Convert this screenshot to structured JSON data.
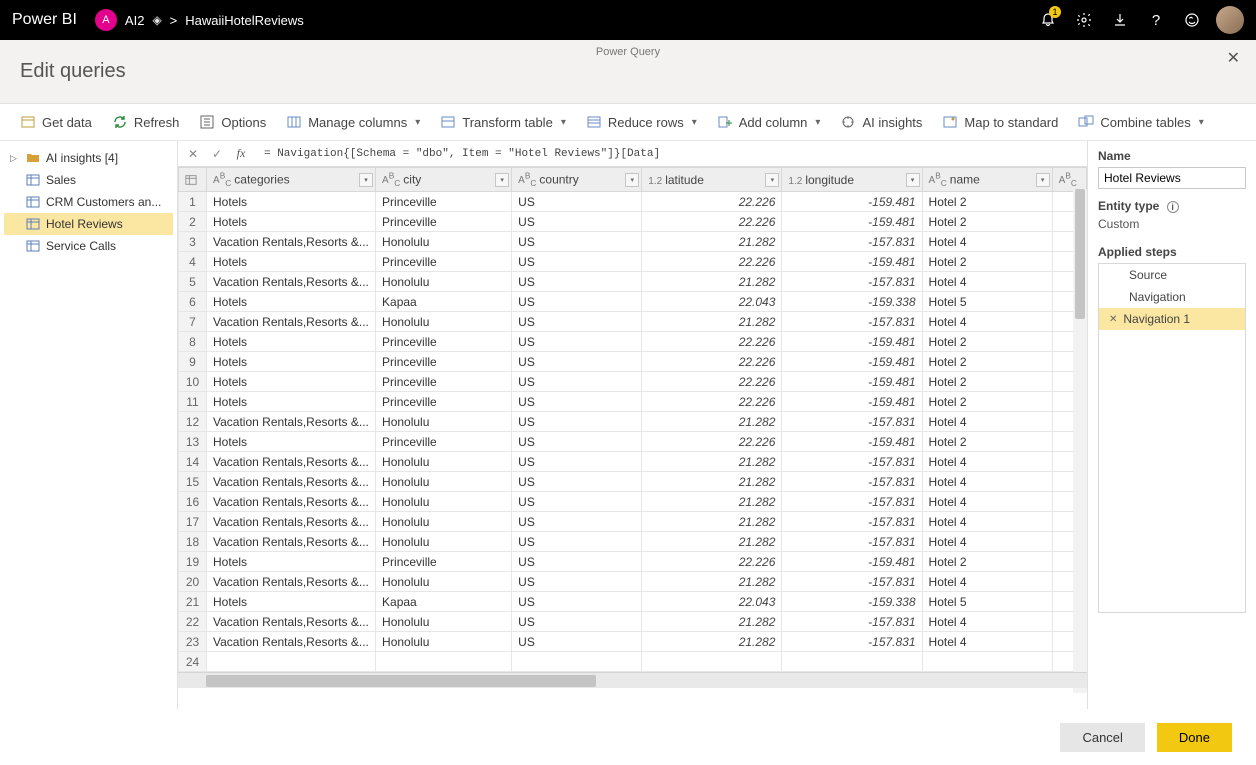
{
  "titlebar": {
    "app_name": "Power BI",
    "workspace_initial": "A",
    "workspace_name": "AI2",
    "breadcrumb_sep": ">",
    "file_name": "HawaiiHotelReviews",
    "notif_count": "1"
  },
  "dialog": {
    "subtitle": "Power Query",
    "title": "Edit queries"
  },
  "ribbon": {
    "get_data": "Get data",
    "refresh": "Refresh",
    "options": "Options",
    "manage_columns": "Manage columns",
    "transform_table": "Transform table",
    "reduce_rows": "Reduce rows",
    "add_column": "Add column",
    "ai_insights": "AI insights",
    "map_standard": "Map to standard",
    "combine_tables": "Combine tables"
  },
  "queries": {
    "folder": "AI insights [4]",
    "items": [
      "Sales",
      "CRM Customers an...",
      "Hotel Reviews",
      "Service Calls"
    ],
    "selected_index": 2
  },
  "formula": "=   Navigation{[Schema = \"dbo\", Item = \"Hotel Reviews\"]}[Data]",
  "columns": [
    {
      "name": "categories",
      "type": "text"
    },
    {
      "name": "city",
      "type": "text"
    },
    {
      "name": "country",
      "type": "text"
    },
    {
      "name": "latitude",
      "type": "number"
    },
    {
      "name": "longitude",
      "type": "number"
    },
    {
      "name": "name",
      "type": "text"
    }
  ],
  "rows": [
    {
      "n": 1,
      "categories": "Hotels",
      "city": "Princeville",
      "country": "US",
      "latitude": "22.226",
      "longitude": "-159.481",
      "name": "Hotel 2"
    },
    {
      "n": 2,
      "categories": "Hotels",
      "city": "Princeville",
      "country": "US",
      "latitude": "22.226",
      "longitude": "-159.481",
      "name": "Hotel 2"
    },
    {
      "n": 3,
      "categories": "Vacation Rentals,Resorts &...",
      "city": "Honolulu",
      "country": "US",
      "latitude": "21.282",
      "longitude": "-157.831",
      "name": "Hotel 4"
    },
    {
      "n": 4,
      "categories": "Hotels",
      "city": "Princeville",
      "country": "US",
      "latitude": "22.226",
      "longitude": "-159.481",
      "name": "Hotel 2"
    },
    {
      "n": 5,
      "categories": "Vacation Rentals,Resorts &...",
      "city": "Honolulu",
      "country": "US",
      "latitude": "21.282",
      "longitude": "-157.831",
      "name": "Hotel 4"
    },
    {
      "n": 6,
      "categories": "Hotels",
      "city": "Kapaa",
      "country": "US",
      "latitude": "22.043",
      "longitude": "-159.338",
      "name": "Hotel 5"
    },
    {
      "n": 7,
      "categories": "Vacation Rentals,Resorts &...",
      "city": "Honolulu",
      "country": "US",
      "latitude": "21.282",
      "longitude": "-157.831",
      "name": "Hotel 4"
    },
    {
      "n": 8,
      "categories": "Hotels",
      "city": "Princeville",
      "country": "US",
      "latitude": "22.226",
      "longitude": "-159.481",
      "name": "Hotel 2"
    },
    {
      "n": 9,
      "categories": "Hotels",
      "city": "Princeville",
      "country": "US",
      "latitude": "22.226",
      "longitude": "-159.481",
      "name": "Hotel 2"
    },
    {
      "n": 10,
      "categories": "Hotels",
      "city": "Princeville",
      "country": "US",
      "latitude": "22.226",
      "longitude": "-159.481",
      "name": "Hotel 2"
    },
    {
      "n": 11,
      "categories": "Hotels",
      "city": "Princeville",
      "country": "US",
      "latitude": "22.226",
      "longitude": "-159.481",
      "name": "Hotel 2"
    },
    {
      "n": 12,
      "categories": "Vacation Rentals,Resorts &...",
      "city": "Honolulu",
      "country": "US",
      "latitude": "21.282",
      "longitude": "-157.831",
      "name": "Hotel 4"
    },
    {
      "n": 13,
      "categories": "Hotels",
      "city": "Princeville",
      "country": "US",
      "latitude": "22.226",
      "longitude": "-159.481",
      "name": "Hotel 2"
    },
    {
      "n": 14,
      "categories": "Vacation Rentals,Resorts &...",
      "city": "Honolulu",
      "country": "US",
      "latitude": "21.282",
      "longitude": "-157.831",
      "name": "Hotel 4"
    },
    {
      "n": 15,
      "categories": "Vacation Rentals,Resorts &...",
      "city": "Honolulu",
      "country": "US",
      "latitude": "21.282",
      "longitude": "-157.831",
      "name": "Hotel 4"
    },
    {
      "n": 16,
      "categories": "Vacation Rentals,Resorts &...",
      "city": "Honolulu",
      "country": "US",
      "latitude": "21.282",
      "longitude": "-157.831",
      "name": "Hotel 4"
    },
    {
      "n": 17,
      "categories": "Vacation Rentals,Resorts &...",
      "city": "Honolulu",
      "country": "US",
      "latitude": "21.282",
      "longitude": "-157.831",
      "name": "Hotel 4"
    },
    {
      "n": 18,
      "categories": "Vacation Rentals,Resorts &...",
      "city": "Honolulu",
      "country": "US",
      "latitude": "21.282",
      "longitude": "-157.831",
      "name": "Hotel 4"
    },
    {
      "n": 19,
      "categories": "Hotels",
      "city": "Princeville",
      "country": "US",
      "latitude": "22.226",
      "longitude": "-159.481",
      "name": "Hotel 2"
    },
    {
      "n": 20,
      "categories": "Vacation Rentals,Resorts &...",
      "city": "Honolulu",
      "country": "US",
      "latitude": "21.282",
      "longitude": "-157.831",
      "name": "Hotel 4"
    },
    {
      "n": 21,
      "categories": "Hotels",
      "city": "Kapaa",
      "country": "US",
      "latitude": "22.043",
      "longitude": "-159.338",
      "name": "Hotel 5"
    },
    {
      "n": 22,
      "categories": "Vacation Rentals,Resorts &...",
      "city": "Honolulu",
      "country": "US",
      "latitude": "21.282",
      "longitude": "-157.831",
      "name": "Hotel 4"
    },
    {
      "n": 23,
      "categories": "Vacation Rentals,Resorts &...",
      "city": "Honolulu",
      "country": "US",
      "latitude": "21.282",
      "longitude": "-157.831",
      "name": "Hotel 4"
    },
    {
      "n": 24,
      "categories": "",
      "city": "",
      "country": "",
      "latitude": "",
      "longitude": "",
      "name": ""
    }
  ],
  "panel": {
    "name_label": "Name",
    "name_value": "Hotel Reviews",
    "entity_type_label": "Entity type",
    "entity_type_value": "Custom",
    "applied_steps_label": "Applied steps",
    "steps": [
      "Source",
      "Navigation",
      "Navigation 1"
    ],
    "selected_step_index": 2
  },
  "footer": {
    "cancel": "Cancel",
    "done": "Done"
  }
}
